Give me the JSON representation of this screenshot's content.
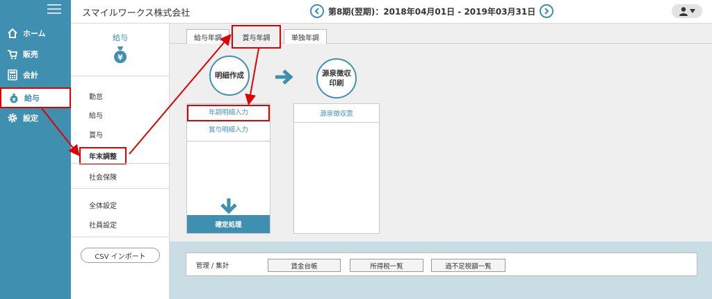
{
  "sidebar": {
    "items": [
      {
        "label": "ホーム",
        "icon": "home-icon"
      },
      {
        "label": "販売",
        "icon": "cart-icon"
      },
      {
        "label": "会計",
        "icon": "calculator-icon"
      },
      {
        "label": "給与",
        "icon": "money-bag-icon"
      },
      {
        "label": "設定",
        "icon": "gear-icon"
      }
    ]
  },
  "header": {
    "company": "スマイルワークス株式会社",
    "period": "第8期(翌期)：2018年04月01日 - 2019年03月31日"
  },
  "subside": {
    "title": "給与",
    "items": [
      "勤怠",
      "給与",
      "賞与",
      "年末調整",
      "社会保険",
      "全体設定",
      "社員設定"
    ],
    "csv_label": "CSV インポート"
  },
  "tabs": [
    "給与年調",
    "賞与年調",
    "単独年調"
  ],
  "steps": {
    "create": "明細作成",
    "print": "源泉徴収印刷",
    "print_line1": "源泉徴収",
    "print_line2": "印刷"
  },
  "left_box": {
    "items": [
      "年調明細入力",
      "賞与明細入力"
    ],
    "confirm": "確定処理"
  },
  "right_box": {
    "items": [
      "源泉徴収票"
    ]
  },
  "kanri": {
    "label": "管理 / 集計",
    "buttons": [
      "賃金台帳",
      "所得税一覧",
      "過不足税額一覧"
    ]
  },
  "colors": {
    "accent": "#3f8fb0",
    "highlight": "#e00000"
  }
}
